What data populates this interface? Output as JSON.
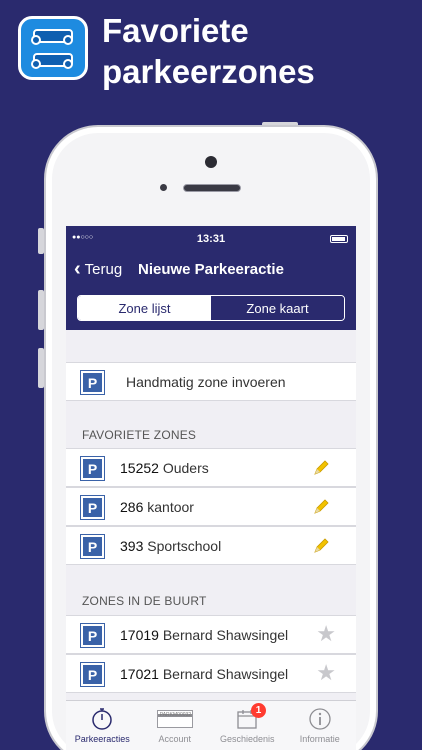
{
  "promo": {
    "title_line1": "Favoriete",
    "title_line2": "parkeerzones"
  },
  "status_bar": {
    "signal": "●●○○○",
    "time": "13:31"
  },
  "nav": {
    "back_label": "Terug",
    "title": "Nieuwe Parkeeractie"
  },
  "segments": {
    "list_label": "Zone lijst",
    "map_label": "Zone kaart",
    "selected": "Zone lijst"
  },
  "manual_entry": {
    "icon_letter": "P",
    "label": "Handmatig zone invoeren"
  },
  "favorites": {
    "header": "FAVORIETE ZONES",
    "items": [
      {
        "code": "15252",
        "name": "Ouders",
        "icon_letter": "P",
        "action_icon": "pencil-icon"
      },
      {
        "code": "286",
        "name": "kantoor",
        "icon_letter": "P",
        "action_icon": "pencil-icon"
      },
      {
        "code": "393",
        "name": "Sportschool",
        "icon_letter": "P",
        "action_icon": "pencil-icon"
      }
    ]
  },
  "nearby": {
    "header": "ZONES IN DE BUURT",
    "items": [
      {
        "code": "17019",
        "name": "Bernard Shawsingel",
        "icon_letter": "P",
        "action_icon": "star-icon"
      },
      {
        "code": "17021",
        "name": "Bernard Shawsingel",
        "icon_letter": "P",
        "action_icon": "star-icon"
      }
    ]
  },
  "tabbar": {
    "items": [
      {
        "label": "Parkeeracties",
        "icon": "stopwatch-icon",
        "active": true
      },
      {
        "label": "Account",
        "icon": "card-icon",
        "card_text": "PARKM00032",
        "active": false
      },
      {
        "label": "Geschiedenis",
        "icon": "calendar-icon",
        "badge": "1",
        "active": false
      },
      {
        "label": "Informatie",
        "icon": "info-icon",
        "active": false
      }
    ]
  },
  "colors": {
    "background": "#2a2a6e",
    "accent": "#2a2a6e",
    "parking_badge": "#3a62a8",
    "pencil": "#f2c200",
    "badge": "#ff3b30"
  }
}
